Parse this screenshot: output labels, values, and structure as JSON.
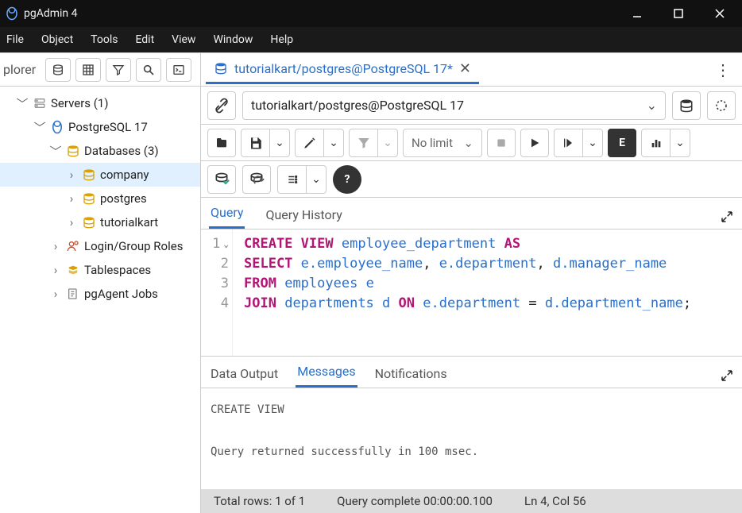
{
  "window": {
    "title": "pgAdmin 4"
  },
  "menu": {
    "items": [
      "File",
      "Object",
      "Tools",
      "Edit",
      "View",
      "Window",
      "Help"
    ]
  },
  "sidebar": {
    "title": "plorer",
    "tree": {
      "servers_label": "Servers (1)",
      "pg17_label": "PostgreSQL 17",
      "databases_label": "Databases (3)",
      "db_company": "company",
      "db_postgres": "postgres",
      "db_tutorialkart": "tutorialkart",
      "roles_label": "Login/Group Roles",
      "tablespaces_label": "Tablespaces",
      "pgagent_label": "pgAgent Jobs"
    }
  },
  "conn_tab": {
    "label": "tutorialkart/postgres@PostgreSQL 17*"
  },
  "conn_select": {
    "value": "tutorialkart/postgres@PostgreSQL 17"
  },
  "toolbar": {
    "limit_label": "No limit"
  },
  "editor_tabs": {
    "query": "Query",
    "history": "Query History"
  },
  "code": {
    "line1_a": "CREATE",
    "line1_b": "VIEW",
    "line1_c": "employee_department",
    "line1_d": "AS",
    "line2_a": "SELECT",
    "line2_b": "e.employee_name",
    "line2_c": "e.department",
    "line2_d": "d.manager_name",
    "line3_a": "FROM",
    "line3_b": "employees",
    "line3_c": "e",
    "line4_a": "JOIN",
    "line4_b": "departments",
    "line4_c": "d",
    "line4_d": "ON",
    "line4_e": "e.department",
    "line4_eq": "=",
    "line4_f": "d.department_name",
    "line4_sc": ";"
  },
  "gutter": {
    "l1": "1",
    "l2": "2",
    "l3": "3",
    "l4": "4"
  },
  "output_tabs": {
    "data": "Data Output",
    "messages": "Messages",
    "notifications": "Notifications"
  },
  "messages": {
    "line1": "CREATE VIEW",
    "line2": "",
    "line3": "Query returned successfully in 100 msec."
  },
  "status": {
    "rows": "Total rows: 1 of 1",
    "complete": "Query complete 00:00:00.100",
    "pos": "Ln 4, Col 56"
  }
}
